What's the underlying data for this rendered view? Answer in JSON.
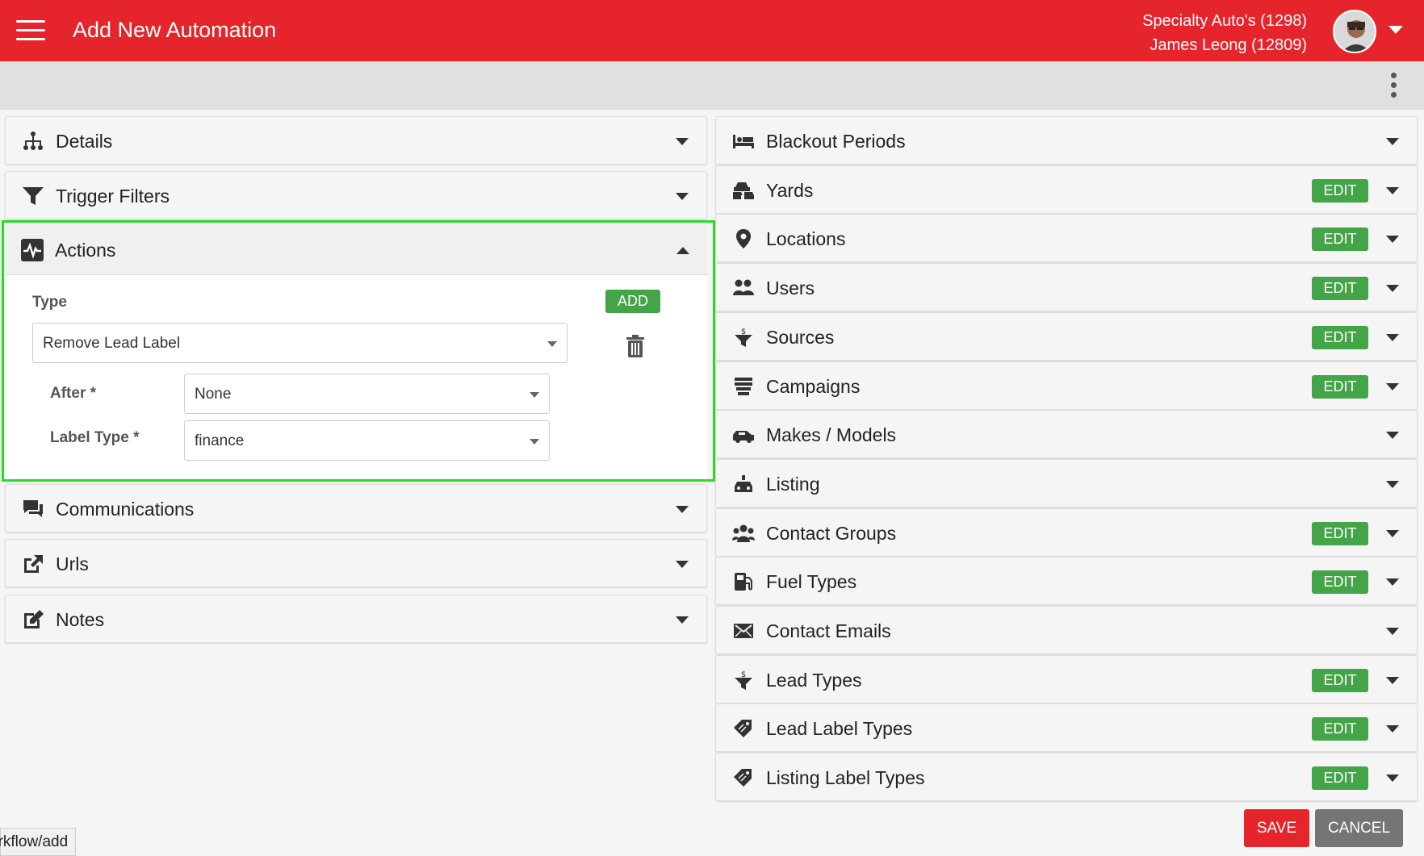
{
  "header": {
    "title": "Add New Automation",
    "account_line1": "Specialty Auto's (1298)",
    "account_line2": "James Leong (12809)",
    "brand_color": "#e5242b"
  },
  "left_panels": [
    {
      "label": "Details",
      "icon": "sitemap-icon"
    },
    {
      "label": "Trigger Filters",
      "icon": "filter-icon"
    },
    {
      "label": "Actions",
      "icon": "heartbeat-icon",
      "expanded": true
    },
    {
      "label": "Communications",
      "icon": "comments-icon"
    },
    {
      "label": "Urls",
      "icon": "external-link-icon"
    },
    {
      "label": "Notes",
      "icon": "edit-note-icon"
    }
  ],
  "actions": {
    "type_label": "Type",
    "add_label": "ADD",
    "type_value": "Remove Lead Label",
    "after_label": "After *",
    "after_value": "None",
    "label_type_label": "Label Type *",
    "label_type_value": "finance"
  },
  "right_panels": [
    {
      "label": "Blackout Periods",
      "icon": "bed-icon",
      "edit": ""
    },
    {
      "label": "Yards",
      "icon": "cars-icon",
      "edit": "EDIT"
    },
    {
      "label": "Locations",
      "icon": "map-marker-icon",
      "edit": "EDIT"
    },
    {
      "label": "Users",
      "icon": "users-icon",
      "edit": "EDIT"
    },
    {
      "label": "Sources",
      "icon": "funnel-dollar-icon",
      "edit": "EDIT"
    },
    {
      "label": "Campaigns",
      "icon": "layers-icon",
      "edit": "EDIT"
    },
    {
      "label": "Makes / Models",
      "icon": "car-side-icon",
      "edit": ""
    },
    {
      "label": "Listing",
      "icon": "car-listing-icon",
      "edit": ""
    },
    {
      "label": "Contact Groups",
      "icon": "user-group-icon",
      "edit": "EDIT"
    },
    {
      "label": "Fuel Types",
      "icon": "gas-pump-icon",
      "edit": "EDIT"
    },
    {
      "label": "Contact Emails",
      "icon": "envelope-icon",
      "edit": ""
    },
    {
      "label": "Lead Types",
      "icon": "funnel-dollar-icon",
      "edit": "EDIT"
    },
    {
      "label": "Lead Label Types",
      "icon": "tags-icon",
      "edit": "EDIT"
    },
    {
      "label": "Listing Label Types",
      "icon": "tags-icon",
      "edit": "EDIT"
    }
  ],
  "footer": {
    "save_label": "SAVE",
    "cancel_label": "CANCEL",
    "status_url": "orkflow/add"
  }
}
